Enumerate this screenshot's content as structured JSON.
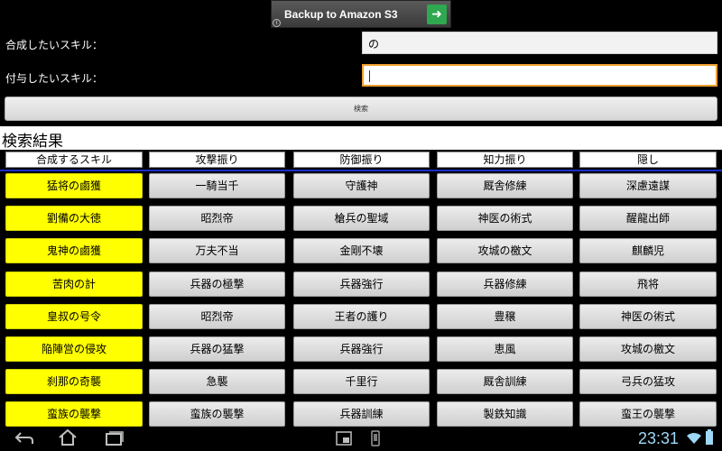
{
  "ad": {
    "text": "Backup to Amazon S3",
    "button_icon": "arrow-right-icon",
    "info_icon": "info-icon",
    "info_glyph": "i"
  },
  "form": {
    "skill_merge_label": "合成したいスキル：",
    "skill_merge_value": "の",
    "skill_grant_label": "付与したいスキル：",
    "skill_grant_value": "",
    "search_button": "検索"
  },
  "results": {
    "title": "検索結果",
    "headers": [
      "合成するスキル",
      "攻撃振り",
      "防御振り",
      "知力振り",
      "隠し"
    ],
    "rows": [
      [
        "猛将の鹵獲",
        "一騎当千",
        "守護神",
        "厩舎修練",
        "深慮遠謀"
      ],
      [
        "劉備の大徳",
        "昭烈帝",
        "槍兵の聖域",
        "神医の術式",
        "醒龍出師"
      ],
      [
        "鬼神の鹵獲",
        "万夫不当",
        "金剛不壊",
        "攻城の檄文",
        "麒麟児"
      ],
      [
        "苦肉の計",
        "兵器の極撃",
        "兵器強行",
        "兵器修練",
        "飛将"
      ],
      [
        "皇叔の号令",
        "昭烈帝",
        "王者の護り",
        "豊穣",
        "神医の術式"
      ],
      [
        "陥陣営の侵攻",
        "兵器の猛撃",
        "兵器強行",
        "恵風",
        "攻城の檄文"
      ],
      [
        "刹那の奇襲",
        "急襲",
        "千里行",
        "厩舎訓練",
        "弓兵の猛攻"
      ],
      [
        "蛮族の襲撃",
        "蛮族の襲撃",
        "兵器訓練",
        "製鉄知識",
        "蛮王の襲撃"
      ]
    ]
  },
  "navbar": {
    "time": "23:31",
    "back_icon": "back-icon",
    "home_icon": "home-icon",
    "recents_icon": "recent-apps-icon",
    "wifi_icon": "wifi-icon",
    "battery_icon": "battery-icon"
  },
  "colors": {
    "accent_line": "#1a2dcc",
    "skill_highlight": "#ffff00",
    "clock": "#9ed8f5",
    "focus_border": "#f0a030"
  }
}
